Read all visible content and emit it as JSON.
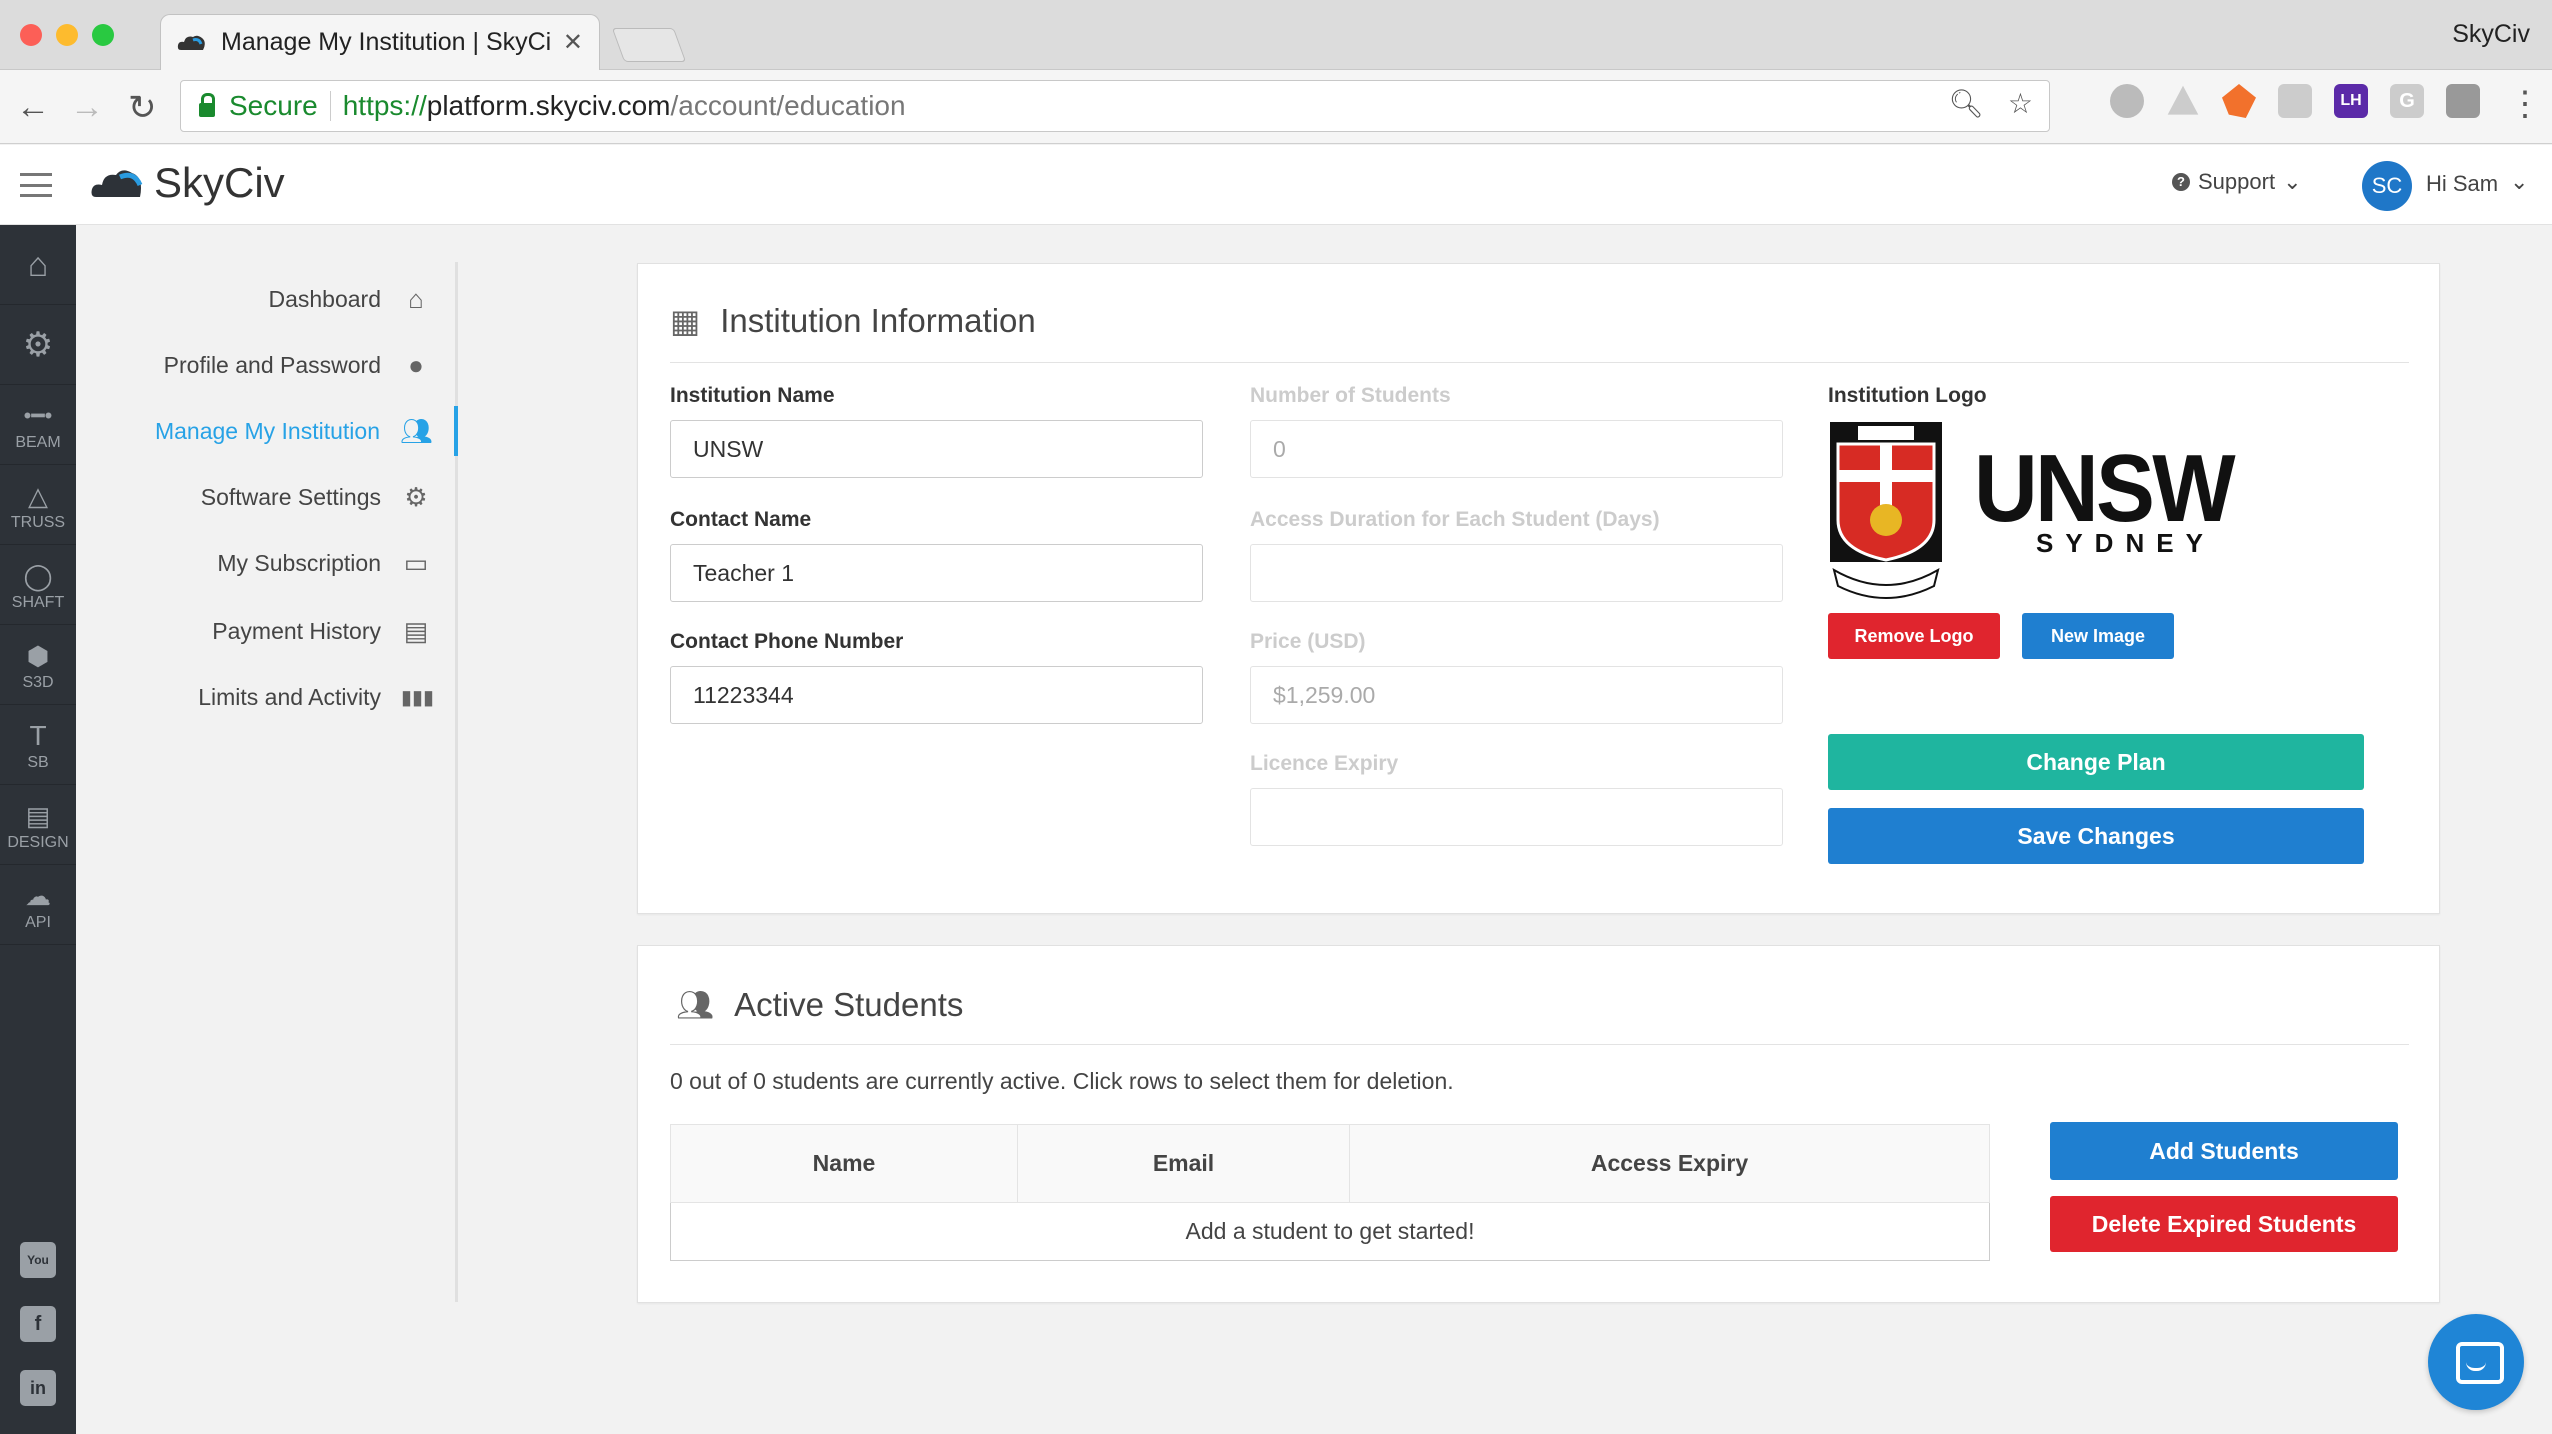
{
  "browser": {
    "tab_title": "Manage My Institution | SkyCi",
    "profile_name": "SkyCiv",
    "secure_label": "Secure",
    "url_proto": "https://",
    "url_host": "platform.skyciv.com",
    "url_path": "/account/education",
    "extensions": [
      "LH",
      "G"
    ]
  },
  "header": {
    "brand": "SkyCiv",
    "support_label": "Support",
    "avatar_initials": "SC",
    "greeting": "Hi Sam"
  },
  "rail": {
    "items": [
      {
        "icon": "home-icon",
        "label": ""
      },
      {
        "icon": "gear-icon",
        "label": ""
      },
      {
        "icon": "beam-icon",
        "label": "BEAM"
      },
      {
        "icon": "truss-icon",
        "label": "TRUSS"
      },
      {
        "icon": "shaft-icon",
        "label": "SHAFT"
      },
      {
        "icon": "cube-icon",
        "label": "S3D"
      },
      {
        "icon": "section-icon",
        "label": "SB"
      },
      {
        "icon": "design-icon",
        "label": "DESIGN"
      },
      {
        "icon": "api-icon",
        "label": "API"
      }
    ],
    "social": [
      "youtube-icon",
      "facebook-icon",
      "linkedin-icon"
    ]
  },
  "sidenav": {
    "items": [
      {
        "label": "Dashboard",
        "icon": "home-icon"
      },
      {
        "label": "Profile and Password",
        "icon": "user-icon"
      },
      {
        "label": "Manage My Institution",
        "icon": "users-icon",
        "active": true
      },
      {
        "label": "Software Settings",
        "icon": "gear-icon"
      },
      {
        "label": "My Subscription",
        "icon": "credit-card-icon"
      },
      {
        "label": "Payment History",
        "icon": "file-icon"
      },
      {
        "label": "Limits and Activity",
        "icon": "bar-chart-icon"
      }
    ]
  },
  "institution": {
    "title": "Institution Information",
    "fields": {
      "name_label": "Institution Name",
      "name_value": "UNSW",
      "contact_label": "Contact Name",
      "contact_value": "Teacher 1",
      "phone_label": "Contact Phone Number",
      "phone_value": "11223344",
      "students_label": "Number of Students",
      "students_value": "0",
      "duration_label": "Access Duration for Each Student (Days)",
      "duration_value": "",
      "price_label": "Price (USD)",
      "price_value": "$1,259.00",
      "expiry_label": "Licence Expiry",
      "expiry_value": ""
    },
    "logo_label": "Institution Logo",
    "logo_text_main": "UNSW",
    "logo_text_sub": "SYDNEY",
    "remove_logo": "Remove Logo",
    "new_image": "New Image",
    "change_plan": "Change Plan",
    "save_changes": "Save Changes"
  },
  "students": {
    "title": "Active Students",
    "summary": "0 out of 0 students are currently active. Click rows to select them for deletion.",
    "columns": [
      "Name",
      "Email",
      "Access Expiry"
    ],
    "empty_message": "Add a student to get started!",
    "add_students": "Add Students",
    "delete_expired": "Delete Expired Students"
  },
  "colors": {
    "accent": "#27a2e6",
    "primary_button": "#1f7fd0",
    "danger_button": "#e0252e",
    "teal_button": "#1fb59f",
    "rail_bg": "#2d3238"
  }
}
